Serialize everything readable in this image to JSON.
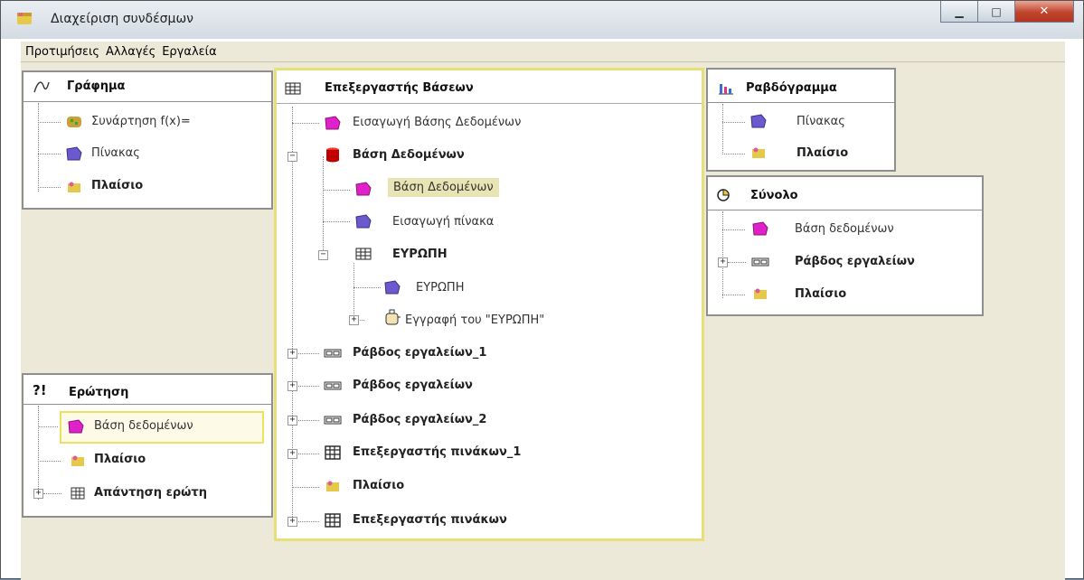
{
  "window": {
    "title": "Διαχείριση συνδέσμων"
  },
  "menu": [
    "Προτιμήσεις",
    "Αλλαγές",
    "Εργαλεία"
  ],
  "graph_panel": {
    "title": "Γράφημα",
    "items": [
      "Συνάρτηση f(x)=",
      "Πίνακας",
      "Πλαίσιο"
    ]
  },
  "db_editor_panel": {
    "title": "Επεξεργαστής Βάσεων",
    "items": [
      "Εισαγωγή Βάσης Δεδομένων",
      "Βάση Δεδομένων",
      "Βάση Δεδομένων",
      "Εισαγωγή πίνακα",
      "ΕΥΡΩΠΗ",
      "ΕΥΡΩΠΗ",
      "Εγγραφή του \"ΕΥΡΩΠΗ\"",
      "Ράβδος εργαλείων_1",
      "Ράβδος εργαλείων",
      "Ράβδος εργαλείων_2",
      "Επεξεργαστής πινάκων_1",
      "Πλαίσιο",
      "Επεξεργαστής πινάκων"
    ]
  },
  "bar_chart_panel": {
    "title": "Ραβδόγραμμα",
    "items": [
      "Πίνακας",
      "Πλαίσιο"
    ]
  },
  "set_panel": {
    "title": "Σύνολο",
    "items": [
      "Βάση δεδομένων",
      "Ράβδος εργαλείων",
      "Πλαίσιο"
    ]
  },
  "question_panel": {
    "title": "Ερώτηση",
    "items": [
      "Βάση δεδομένων",
      "Πλαίσιο",
      "Απάντηση ερώτη"
    ]
  },
  "colors": {
    "title_bg": "#dbe3ea",
    "menu_bg": "#ece9d8",
    "client_bg": "#ece9d8",
    "panel_border": "#8f8f8f",
    "selected_border": "#e7df7a",
    "selection_bg": "#e9e4b4",
    "close_button": "#c0442c"
  }
}
